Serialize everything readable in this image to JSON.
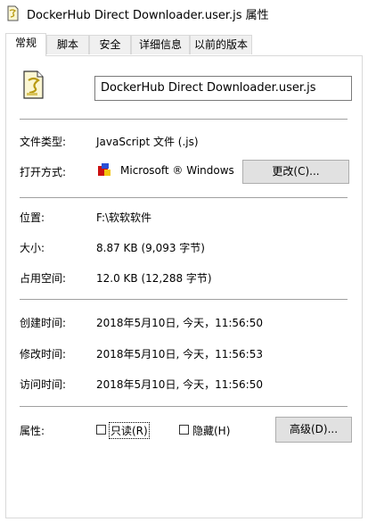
{
  "window": {
    "title": "DockerHub Direct Downloader.user.js 属性"
  },
  "tabs": [
    {
      "label": "常规",
      "active": true
    },
    {
      "label": "脚本",
      "active": false
    },
    {
      "label": "安全",
      "active": false
    },
    {
      "label": "详细信息",
      "active": false
    },
    {
      "label": "以前的版本",
      "active": false
    }
  ],
  "general": {
    "file_name": "DockerHub Direct Downloader.user.js",
    "file_type_label": "文件类型:",
    "file_type_value": "JavaScript 文件 (.js)",
    "open_with_label": "打开方式:",
    "open_with_value": "Microsoft ® Windows",
    "change_button": "更改(C)...",
    "location_label": "位置:",
    "location_value": "F:\\软软软件",
    "size_label": "大小:",
    "size_value": "8.87 KB (9,093 字节)",
    "size_on_disk_label": "占用空间:",
    "size_on_disk_value": "12.0 KB (12,288 字节)",
    "created_label": "创建时间:",
    "created_value": "2018年5月10日, 今天，11:56:50",
    "modified_label": "修改时间:",
    "modified_value": "2018年5月10日, 今天，11:56:53",
    "accessed_label": "访问时间:",
    "accessed_value": "2018年5月10日, 今天，11:56:50",
    "attributes_label": "属性:",
    "readonly_label": "只读(R)",
    "hidden_label": "隐藏(H)",
    "advanced_button": "高级(D)..."
  },
  "icons": {
    "title": "script-file-icon",
    "file": "script-file-icon",
    "open_with": "windows-script-host-icon"
  },
  "colors": {
    "button_bg": "#e1e1e1",
    "border": "#adadad"
  }
}
